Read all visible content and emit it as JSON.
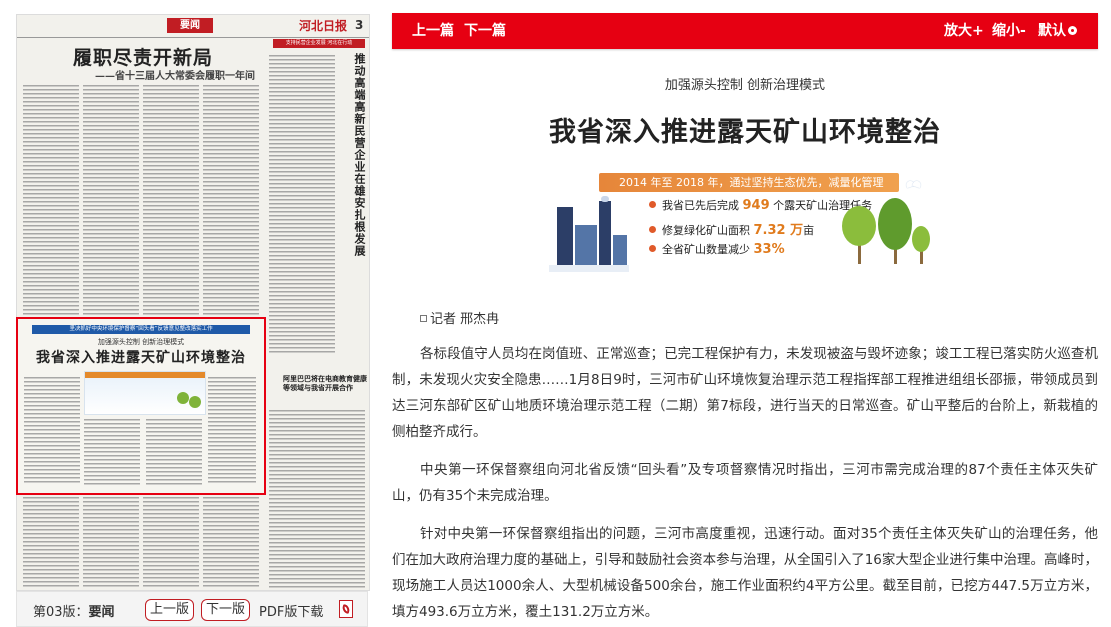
{
  "paper": {
    "section": "要闻",
    "page_no": "3",
    "masthead": "河北日报",
    "headline": "履职尽责开新局",
    "subheadline": "——省十三届人大常委会履职一年间",
    "red_bar": "支持民营企业发展 河北在行动",
    "vertical_headline": "推动高端高新民营企业在雄安扎根发展",
    "highlight_topbar": "坚决抓好中央环境保护督察“回头看”反馈意见整改落实工作",
    "highlight_kicker": "加强源头控制 创新治理模式",
    "highlight_title": "我省深入推进露天矿山环境整治",
    "ad_text": "阿里巴巴将在电商教育健康等领域与我省开展合作"
  },
  "pager": {
    "label_prefix": "第03版：",
    "label_section": "要闻",
    "prev": "上一版",
    "next": "下一版",
    "pdf": "PDF版下载"
  },
  "toolbar": {
    "prev": "上一篇",
    "next": "下一篇",
    "zoom_in": "放大+",
    "zoom_out": "缩小-",
    "reset": "默认"
  },
  "article": {
    "kicker": "加强源头控制 创新治理模式",
    "title": "我省深入推进露天矿山环境整治",
    "infographic": {
      "banner": "2014 年至 2018 年，通过坚持生态优先，减量化管理",
      "items": [
        {
          "pre": "我省已先后完成 ",
          "num": "949",
          "post": " 个露天矿山治理任务"
        },
        {
          "pre": "修复绿化矿山面积 ",
          "num": "7.32 万",
          "post": "亩"
        },
        {
          "pre": "全省矿山数量减少 ",
          "num": "33%",
          "post": ""
        }
      ]
    },
    "byline": "记者 邢杰冉",
    "paragraphs": [
      "各标段值守人员均在岗值班、正常巡查；已完工程保护有力，未发现被盗与毁坏迹象；竣工工程已落实防火巡查机制，未发现火灾安全隐患……1月8日9时，三河市矿山环境恢复治理示范工程指挥部工程推进组组长邵振，带领成员到达三河东部矿区矿山地质环境治理示范工程（二期）第7标段，进行当天的日常巡查。矿山平整后的台阶上，新栽植的侧柏整齐成行。",
      "中央第一环保督察组向河北省反馈“回头看”及专项督察情况时指出，三河市需完成治理的87个责任主体灭失矿山，仍有35个未完成治理。",
      "针对中央第一环保督察组指出的问题，三河市高度重视，迅速行动。面对35个责任主体灭失矿山的治理任务，他们在加大政府治理力度的基础上，引导和鼓励社会资本参与治理，从全国引入了16家大型企业进行集中治理。高峰时，现场施工人员达1000余人、大型机械设备500余台，施工作业面积约4平方公里。截至目前，已挖方447.5万立方米，填方493.6万立方米，覆土131.2万立方米。"
    ]
  },
  "colors": {
    "brand_red": "#e60012",
    "infographic_orange": "#e6863a",
    "highlight_blue": "#1f5aa8"
  }
}
